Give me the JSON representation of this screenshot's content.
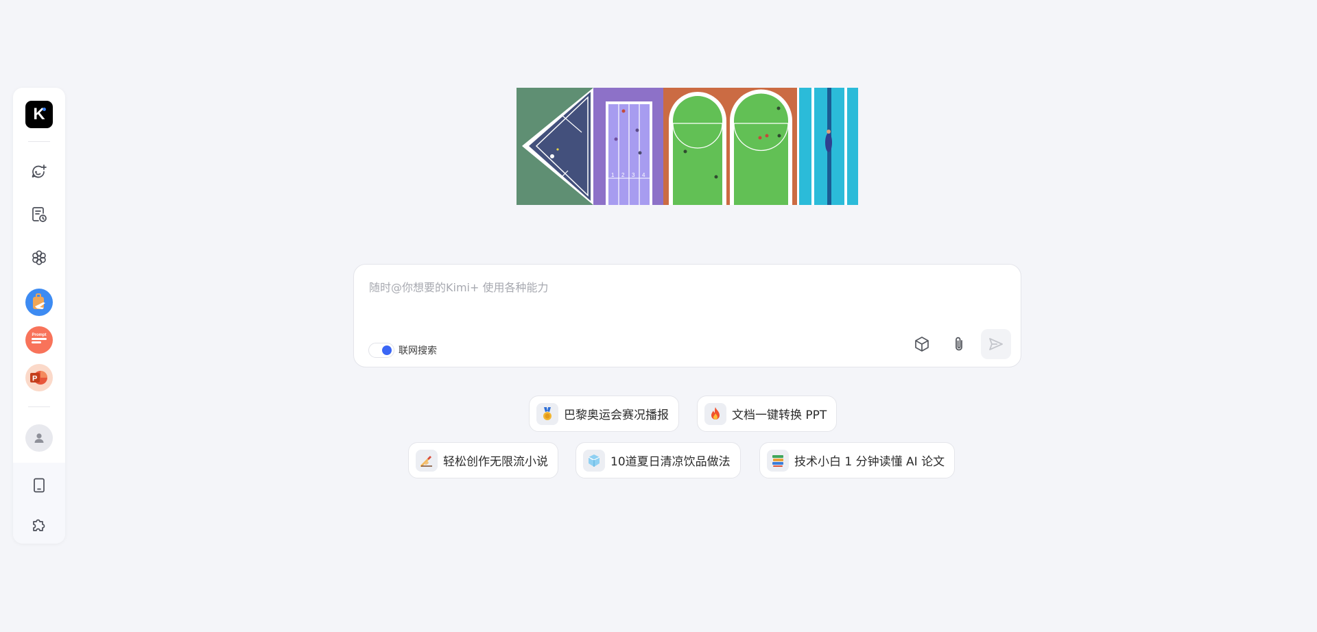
{
  "sidebar": {
    "logo_text": "K",
    "items": [
      {
        "name": "new-chat",
        "icon": "chat-plus-icon"
      },
      {
        "name": "history",
        "icon": "history-doc-icon"
      },
      {
        "name": "explore-kimi-plus",
        "icon": "flower-icon"
      }
    ],
    "apps": [
      {
        "name": "travel-app",
        "icon": "suitcase-plane-icon",
        "color": "#3d8bf2"
      },
      {
        "name": "prompt-app",
        "icon": "prompt-icon",
        "label": "Prompt",
        "color": "#f8735a"
      },
      {
        "name": "ppt-app",
        "icon": "powerpoint-icon",
        "label": "P",
        "color": "#fbd9c9"
      }
    ],
    "bottom": [
      {
        "name": "mobile-app",
        "icon": "tablet-icon"
      },
      {
        "name": "plugins",
        "icon": "puzzle-icon"
      }
    ]
  },
  "input": {
    "placeholder": "随时@你想要的Kimi+ 使用各种能力",
    "web_search_label": "联网搜索",
    "web_search_enabled": true,
    "accent_color": "#3a66f5"
  },
  "suggestions": [
    {
      "text": "巴黎奥运会赛况播报",
      "icon": "medal-icon"
    },
    {
      "text": "文档一键转换 PPT",
      "icon": "fire-icon"
    },
    {
      "text": "轻松创作无限流小说",
      "icon": "writing-hand-icon"
    },
    {
      "text": "10道夏日清凉饮品做法",
      "icon": "ice-cube-icon"
    },
    {
      "text": "技术小白 1 分钟读懂 AI 论文",
      "icon": "books-icon"
    }
  ]
}
